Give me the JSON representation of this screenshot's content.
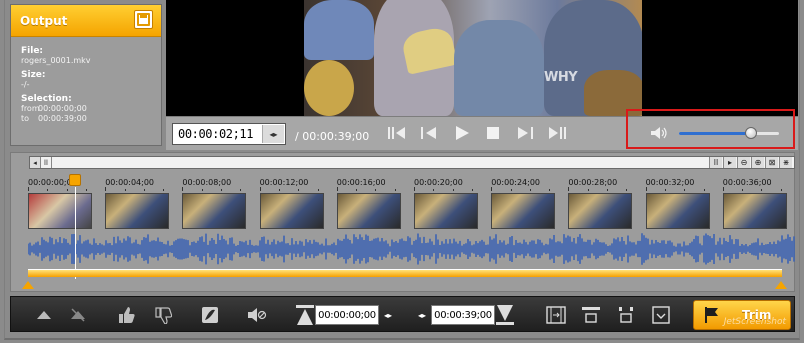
{
  "output": {
    "title": "Output",
    "file_label": "File:",
    "file_value": "rogers_0001.mkv",
    "size_label": "Size:",
    "size_value": "-/-",
    "selection_label": "Selection:",
    "from_label": "from",
    "from_value": "00:00:00;00",
    "to_label": "to",
    "to_value": "00:00:39;00"
  },
  "video": {
    "watermark": "WHY"
  },
  "transport": {
    "current_time": "00:00:02;11",
    "total_time": "/ 00:00:39;00",
    "volume_level": 0.72
  },
  "timeline": {
    "ticks": [
      "00:00:00;00",
      "00:00:04;00",
      "00:00:08;00",
      "00:00:12;00",
      "00:00:16;00",
      "00:00:20;00",
      "00:00:24;00",
      "00:00:28;00",
      "00:00:32;00",
      "00:00:36;00"
    ]
  },
  "toolbar": {
    "start_time": "00:00:00;00",
    "end_time": "00:00:39;00",
    "trim_label": "Trim"
  },
  "watermark": "JetScreenshot"
}
